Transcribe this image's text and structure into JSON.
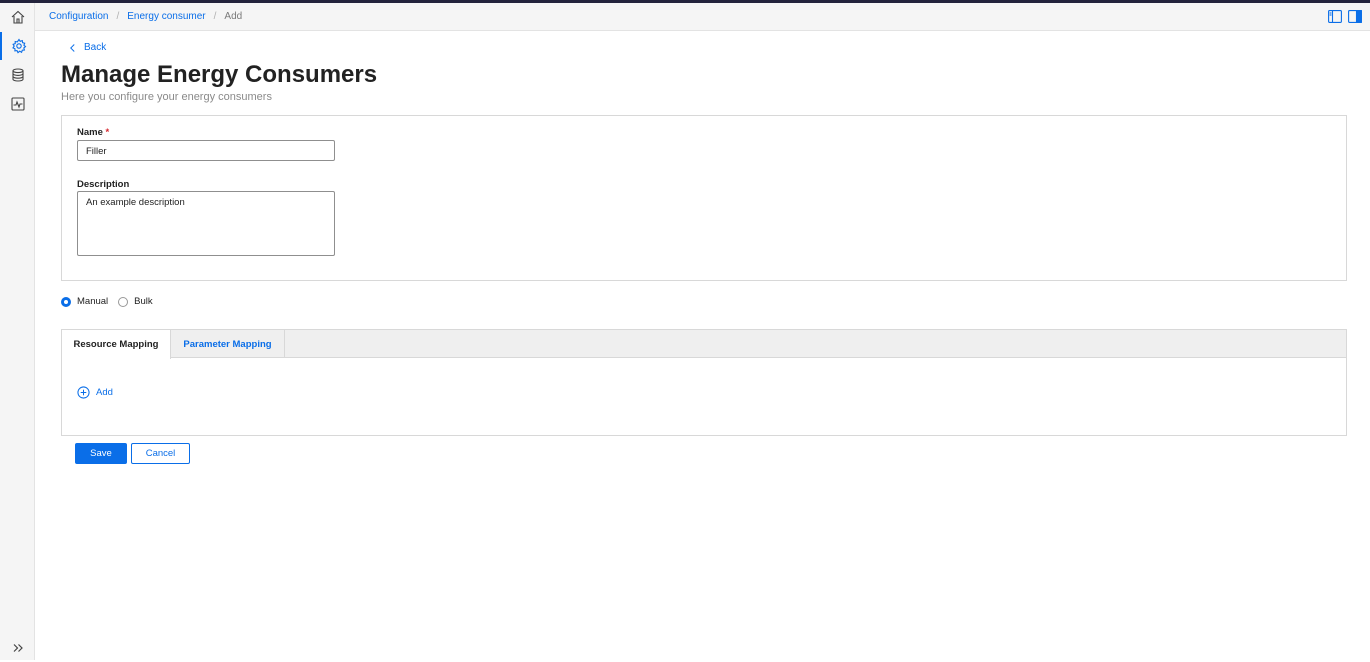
{
  "breadcrumb": [
    "Configuration",
    "Energy consumer",
    "Add"
  ],
  "sidebar": {
    "items": [
      {
        "icon": "home-icon"
      },
      {
        "icon": "gear-icon",
        "active": true
      },
      {
        "icon": "database-icon"
      },
      {
        "icon": "activity-icon"
      }
    ],
    "expand_icon": "chevron-double-right-icon"
  },
  "header_icons": [
    "panel-left-icon",
    "panel-right-icon"
  ],
  "back_label": "Back",
  "page": {
    "title": "Manage Energy Consumers",
    "subtitle": "Here you configure your energy consumers"
  },
  "form": {
    "name_label": "Name",
    "name_required": "*",
    "name_value": "Filler",
    "description_label": "Description",
    "description_value": "An example description"
  },
  "mode": {
    "options": [
      "Manual",
      "Bulk"
    ],
    "selected": "Manual"
  },
  "tabs": [
    {
      "label": "Resource Mapping",
      "active": true
    },
    {
      "label": "Parameter Mapping",
      "active": false
    }
  ],
  "add_label": "Add",
  "buttons": {
    "save": "Save",
    "cancel": "Cancel"
  },
  "colors": {
    "accent": "#0a6ee8",
    "required": "#d6282f",
    "topbar": "#23233c"
  }
}
